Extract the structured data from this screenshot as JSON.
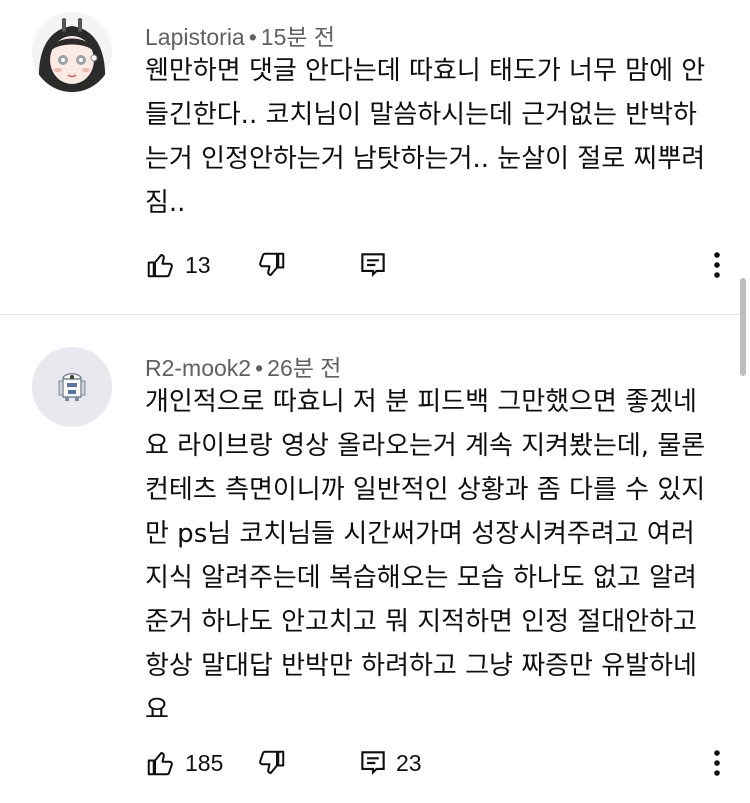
{
  "comments": [
    {
      "author": "Lapistoria",
      "time": "15분 전",
      "separator": "•",
      "lines": [
        "웬만하면 댓글 안다는데 따효니 태도가 너무 맘에 안",
        "들긴한다.. 코치님이 말씀하시는데 근거없는 반박하",
        "는거 인정안하는거 남탓하는거.. 눈살이 절로 찌뿌려",
        "짐.."
      ],
      "likes": "13",
      "replies": ""
    },
    {
      "author": "R2-mook2",
      "time": "26분 전",
      "separator": "•",
      "lines": [
        "개인적으로 따효니 저 분 피드백 그만했으면 좋겠네",
        "요 라이브랑 영상 올라오는거 계속 지켜봤는데, 물론",
        "컨테츠 측면이니까 일반적인 상황과 좀 다를 수 있지",
        "만 ps님 코치님들 시간써가며 성장시켜주려고 여러",
        "지식 알려주는데 복습해오는 모습 하나도 없고 알려",
        "준거 하나도 안고치고 뭐 지적하면 인정 절대안하고",
        "항상 말대답 반박만 하려하고 그냥 짜증만 유발하네",
        "요"
      ],
      "likes": "185",
      "replies": "23"
    }
  ],
  "icons": {
    "like": "thumbs-up-icon",
    "dislike": "thumbs-down-icon",
    "reply": "reply-icon",
    "more": "more-vertical-icon"
  },
  "colors": {
    "text": "#0f0f0f",
    "meta": "#606060",
    "divider": "#e5e5e5",
    "avatar2_bg": "#e8e8ee"
  }
}
